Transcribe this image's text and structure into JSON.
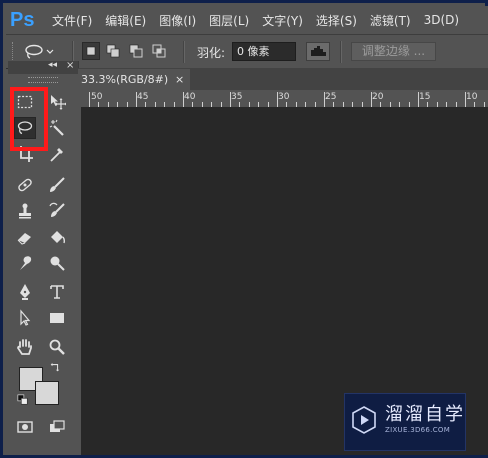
{
  "app": {
    "logo": "Ps"
  },
  "menu": [
    "文件(F)",
    "编辑(E)",
    "图像(I)",
    "图层(L)",
    "文字(Y)",
    "选择(S)",
    "滤镜(T)",
    "3D(D)"
  ],
  "options": {
    "feather_label": "羽化:",
    "feather_value": "0 像素",
    "refine_edge": "调整边缘 ...",
    "current_tool": "lasso"
  },
  "toolbox": {
    "collapse_arrows": "◂◂",
    "close": "×",
    "highlighted_tool": "lasso-tool",
    "highlight_color": "#ff1a1a"
  },
  "document": {
    "tab_title": "33.3%(RGB/8#)",
    "tab_close": "×"
  },
  "ruler": {
    "labels": [
      "50",
      "45",
      "40",
      "35",
      "30",
      "25",
      "20",
      "15",
      "10",
      "5"
    ]
  },
  "watermark": {
    "title": "溜溜自学",
    "url": "ZIXUE.3D66.COM",
    "background": "#0f1d43"
  },
  "colors": {
    "panel": "#535353",
    "canvas": "#282828",
    "accent": "#3aa0ff"
  }
}
